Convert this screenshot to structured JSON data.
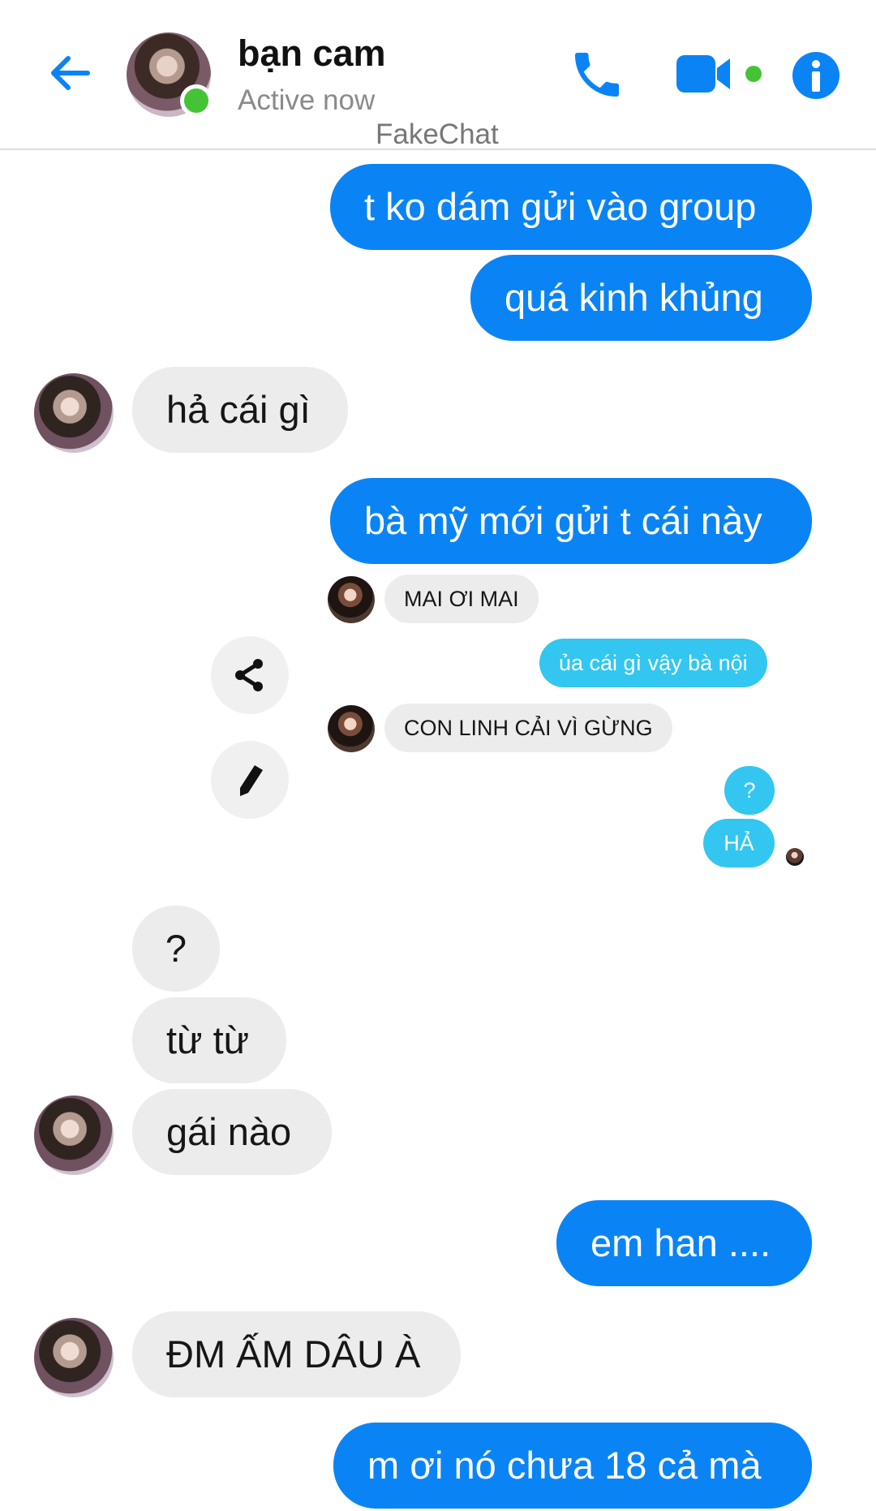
{
  "header": {
    "contact_name": "bạn cam",
    "status": "Active now",
    "watermark": "FakeChat",
    "icons": {
      "back": "arrow-left-icon",
      "call": "phone-icon",
      "video": "video-camera-icon",
      "info": "info-icon"
    },
    "accent_color": "#0a84f5",
    "online_color": "#44c435"
  },
  "messages": [
    {
      "side": "out",
      "text": "t ko dám gửi vào group"
    },
    {
      "side": "out",
      "text": "quá kinh khủng"
    },
    {
      "side": "in",
      "text": "hả cái gì"
    },
    {
      "side": "out",
      "text": "bà mỹ mới gửi t cái này"
    },
    {
      "side": "in",
      "text": "?"
    },
    {
      "side": "in",
      "text": "từ từ"
    },
    {
      "side": "in",
      "text": "gái nào"
    },
    {
      "side": "out",
      "text": "em han ...."
    },
    {
      "side": "in",
      "text": "ĐM ẤM DÂU À"
    },
    {
      "side": "out",
      "text": "m ơi nó chưa 18 cả mà"
    }
  ],
  "shared_screenshot": {
    "messages": [
      {
        "side": "in",
        "text": "MAI ƠI MAI"
      },
      {
        "side": "out",
        "text": "ủa cái gì vậy bà nội"
      },
      {
        "side": "in",
        "text": "CON LINH CẢI VÌ GỪNG"
      },
      {
        "side": "out",
        "text": "?"
      },
      {
        "side": "out",
        "text": "HẢ"
      }
    ],
    "outgoing_color": "#33c6f0"
  },
  "tools": {
    "share_icon": "share-icon",
    "edit_icon": "pencil-icon"
  }
}
